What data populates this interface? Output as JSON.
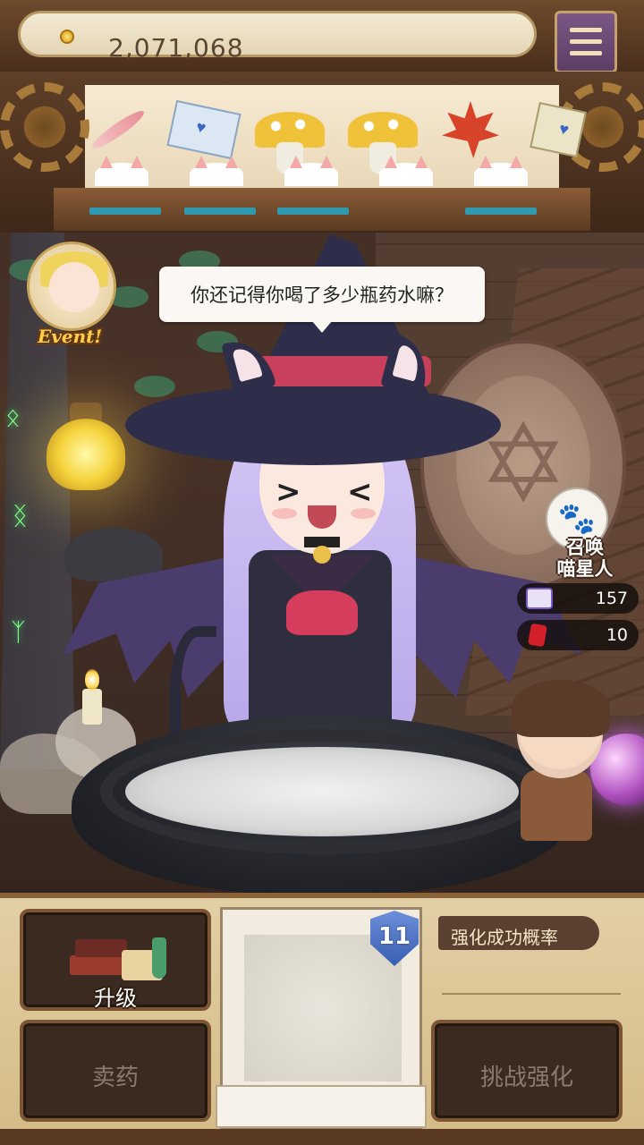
{
  "header": {
    "coins": "2,071,068"
  },
  "shelf": {
    "items": [
      {
        "icon": "feather-icon",
        "progress": 1.0
      },
      {
        "icon": "love-letter-icon",
        "progress": 1.0
      },
      {
        "icon": "yellow-mushroom-icon",
        "progress": 1.0
      },
      {
        "icon": "yellow-mushroom-icon",
        "progress": 1.0
      },
      {
        "icon": "maple-leaf-icon",
        "progress": 1.0
      },
      {
        "icon": "letter-icon",
        "progress": 1.0
      }
    ]
  },
  "dialogue": {
    "text": "你还记得你喝了多少瓶药水嘛？"
  },
  "event": {
    "label": "Event!"
  },
  "summon": {
    "label_line1": "召唤",
    "label_line2": "喵星人",
    "tickets": "157",
    "gems": "10"
  },
  "bottom": {
    "upgrade_label": "升级",
    "sell_label": "卖药",
    "challenge_label": "挑战强化",
    "level": "11",
    "success_rate_label": "强化成功概率"
  },
  "colors": {
    "progress_fill": "#2f9ab0",
    "badge": "#3a5eb2",
    "ticket": "#7a5ac8",
    "gem": "#d21f2a"
  }
}
